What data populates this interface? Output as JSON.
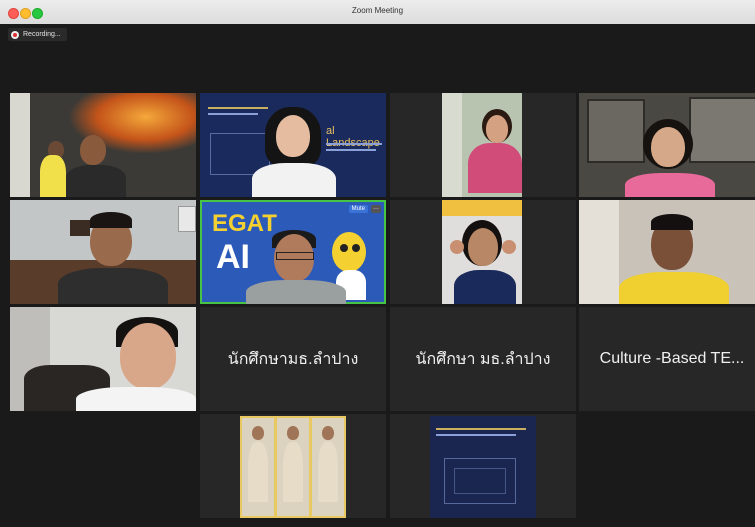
{
  "window": {
    "title": "Zoom Meeting"
  },
  "recording": {
    "label": "Recording..."
  },
  "participants": {
    "slide_title": "al Landscape",
    "egat_text_top": "EGAT",
    "egat_text_bottom": "AI",
    "mute_label": "Mute",
    "more_label": "···",
    "name_1": "นักศึกษามธ.ลำปาง",
    "name_2": "นักศึกษา มธ.ลำปาง",
    "name_3": "Culture -Based TE..."
  },
  "colors": {
    "active_speaker": "#46c446",
    "tile_bg": "#272727",
    "background": "#1a1a1a"
  }
}
